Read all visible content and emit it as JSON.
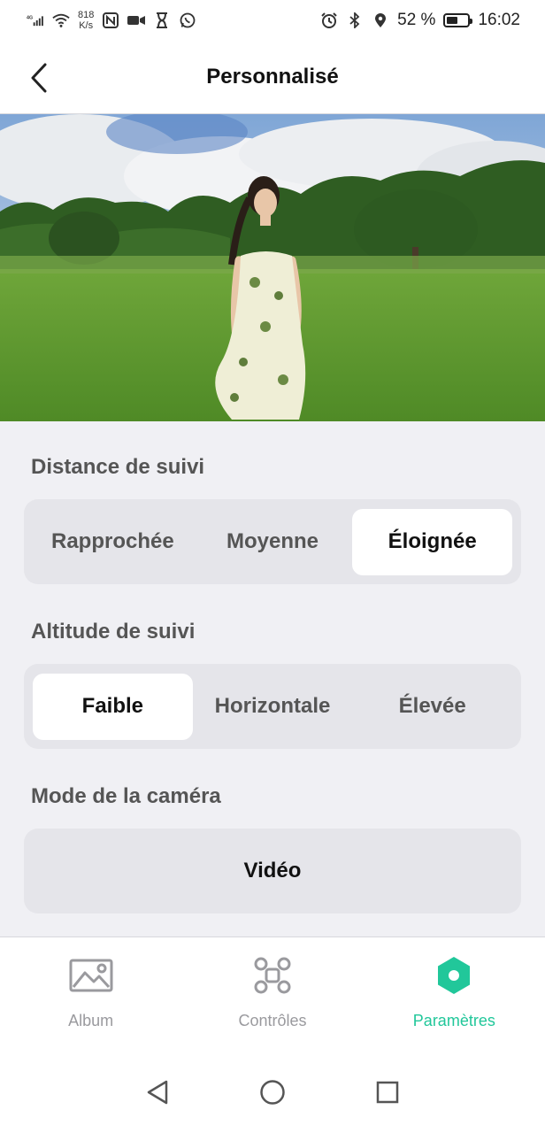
{
  "status_bar": {
    "network_type": "4G",
    "speed_value": "818",
    "speed_unit": "K/s",
    "battery": "52 %",
    "battery_level": 0.52,
    "time": "16:02",
    "icons": [
      "signal-icon",
      "wifi-icon",
      "nfc-icon",
      "video-icon",
      "hourglass-icon",
      "whatsapp-icon",
      "alarm-icon",
      "bluetooth-icon",
      "location-icon",
      "battery-icon"
    ]
  },
  "header": {
    "title": "Personnalisé"
  },
  "tracking_distance": {
    "label": "Distance de suivi",
    "options": [
      "Rapprochée",
      "Moyenne",
      "Éloignée"
    ],
    "selected": "Éloignée"
  },
  "tracking_altitude": {
    "label": "Altitude de suivi",
    "options": [
      "Faible",
      "Horizontale",
      "Élevée"
    ],
    "selected": "Faible"
  },
  "camera_mode": {
    "label": "Mode de la caméra",
    "value": "Vidéo"
  },
  "bottom_nav": {
    "items": [
      {
        "label": "Album",
        "icon": "image-icon"
      },
      {
        "label": "Contrôles",
        "icon": "drone-icon"
      },
      {
        "label": "Paramètres",
        "icon": "settings-icon"
      }
    ],
    "active": "Paramètres",
    "accent_color": "#21c79a"
  }
}
